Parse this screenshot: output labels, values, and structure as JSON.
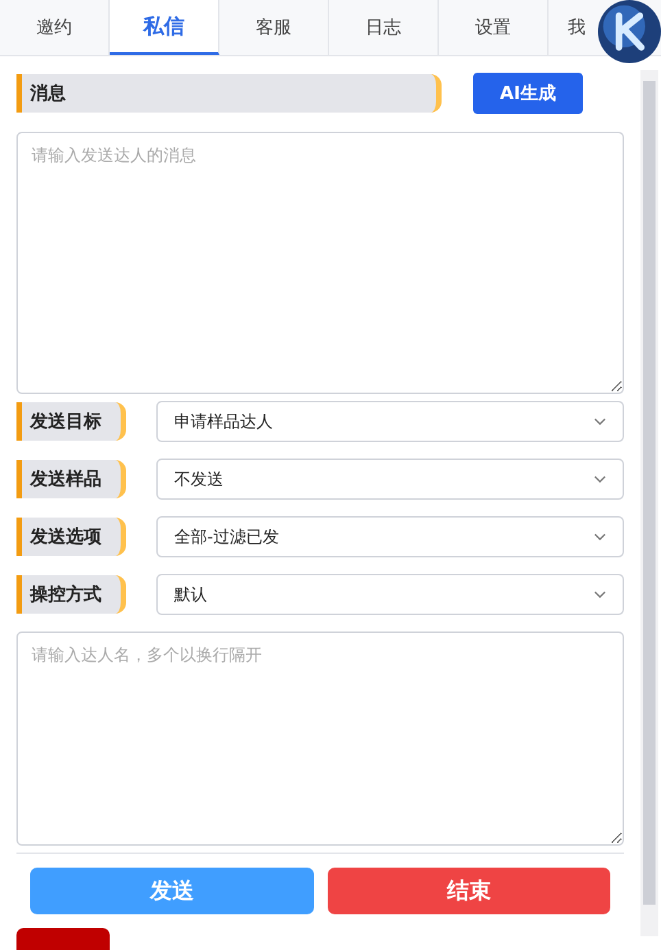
{
  "tabs": [
    {
      "label": "邀约",
      "selected": false
    },
    {
      "label": "私信",
      "selected": true
    },
    {
      "label": "客服",
      "selected": false
    },
    {
      "label": "日志",
      "selected": false
    },
    {
      "label": "设置",
      "selected": false
    },
    {
      "label": "我",
      "selected": false
    }
  ],
  "message": {
    "label": "消息",
    "ai_button": "AI生成",
    "placeholder": "请输入发送达人的消息"
  },
  "options": [
    {
      "label": "发送目标",
      "value": "申请样品达人"
    },
    {
      "label": "发送样品",
      "value": "不发送"
    },
    {
      "label": "发送选项",
      "value": "全部-过滤已发"
    },
    {
      "label": "操控方式",
      "value": "默认"
    }
  ],
  "names": {
    "placeholder": "请输入达人名，多个以换行隔开"
  },
  "buttons": [
    {
      "label": "发送",
      "kind": "primary"
    },
    {
      "label": "结束",
      "kind": "danger"
    }
  ]
}
